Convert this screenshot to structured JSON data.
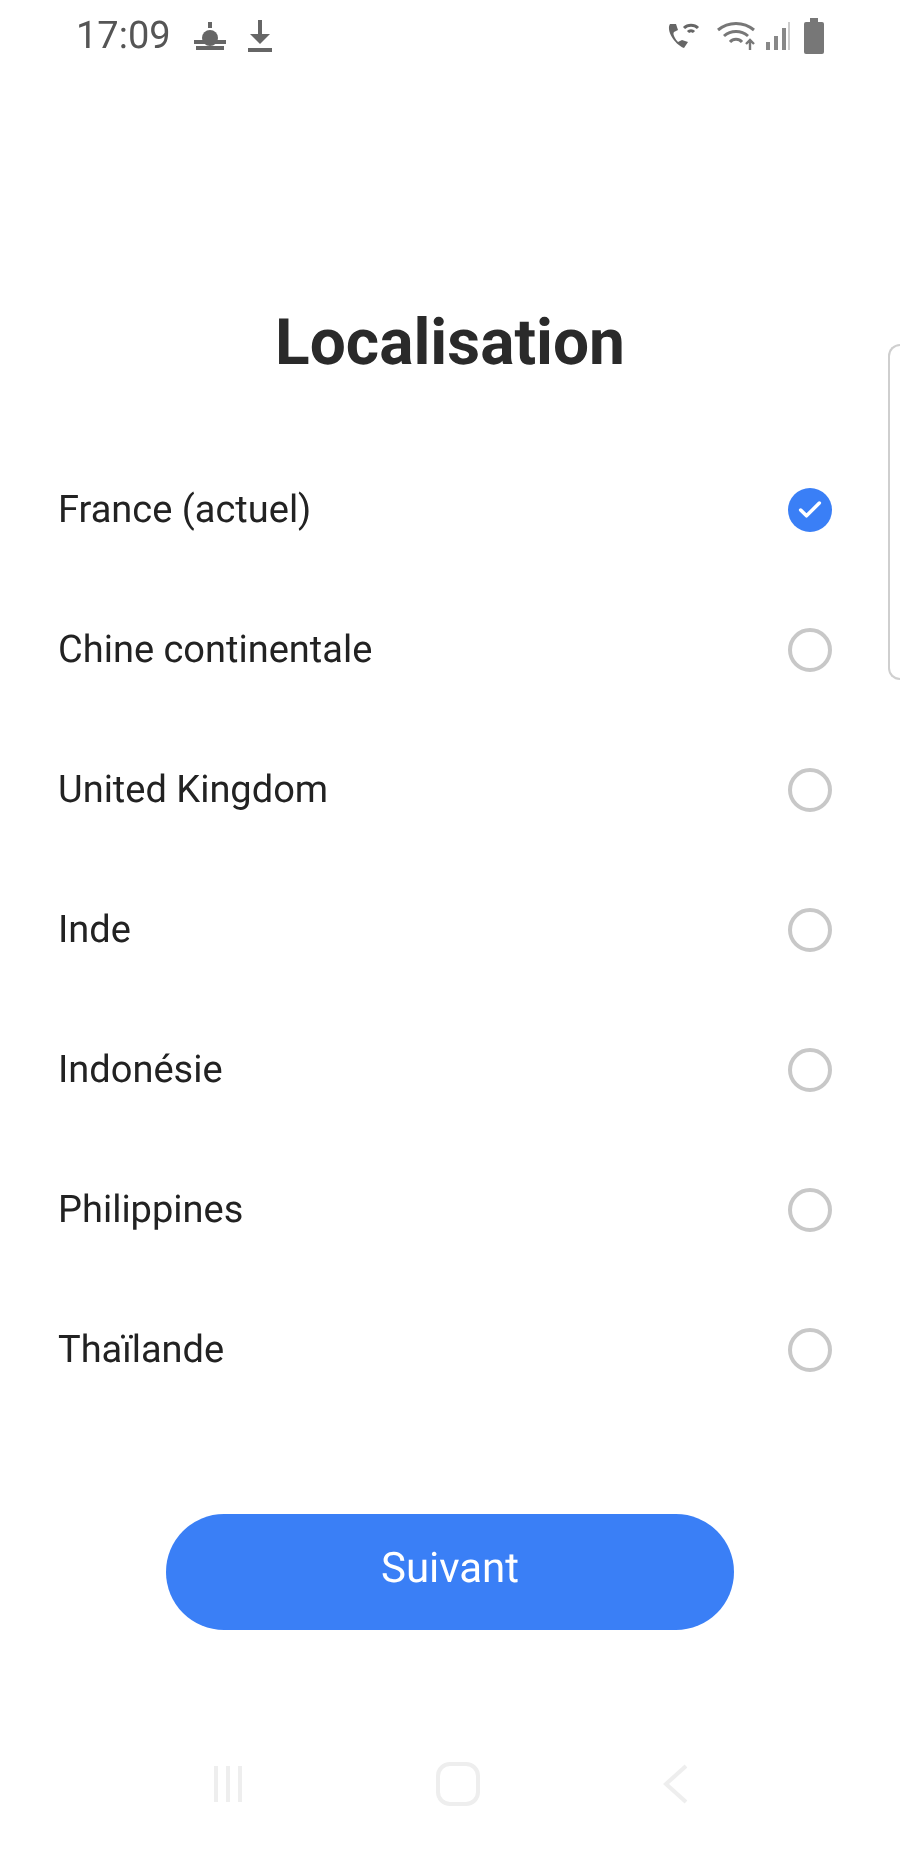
{
  "status_bar": {
    "time": "17:09"
  },
  "title": "Localisation",
  "options": [
    {
      "label": "France (actuel)",
      "selected": true
    },
    {
      "label": "Chine continentale",
      "selected": false
    },
    {
      "label": "United Kingdom",
      "selected": false
    },
    {
      "label": "Inde",
      "selected": false
    },
    {
      "label": "Indonésie",
      "selected": false
    },
    {
      "label": "Philippines",
      "selected": false
    },
    {
      "label": "Thaïlande",
      "selected": false
    }
  ],
  "next_button": "Suivant"
}
